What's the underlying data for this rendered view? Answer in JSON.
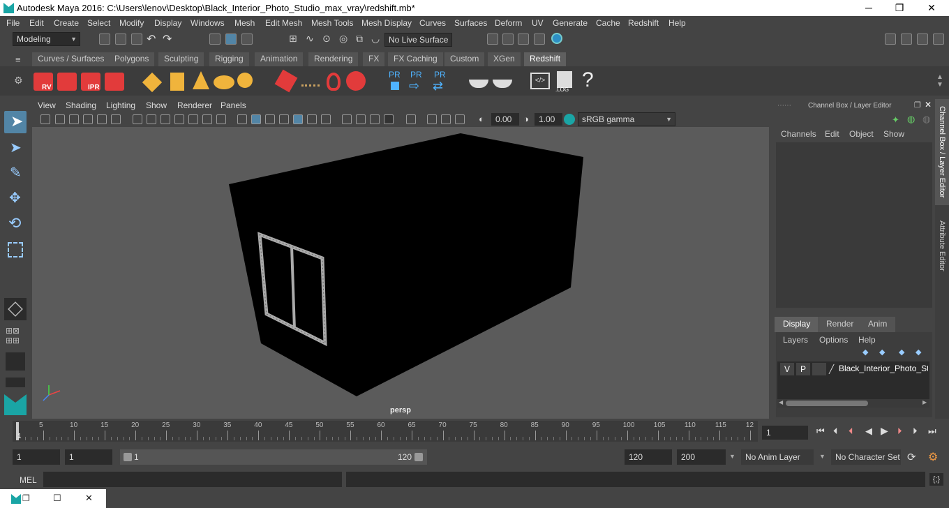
{
  "title": "Autodesk Maya 2016: C:\\Users\\lenov\\Desktop\\Black_Interior_Photo_Studio_max_vray\\redshift.mb*",
  "window_controls": {
    "minimize": "─",
    "maximize": "❐",
    "close": "✕"
  },
  "menu": [
    "File",
    "Edit",
    "Create",
    "Select",
    "Modify",
    "Display",
    "Windows",
    "Mesh",
    "Edit Mesh",
    "Mesh Tools",
    "Mesh Display",
    "Curves",
    "Surfaces",
    "Deform",
    "UV",
    "Generate",
    "Cache",
    "Redshift",
    "Help"
  ],
  "status": {
    "mode": "Modeling",
    "live_surface": "No Live Surface"
  },
  "shelf_tabs": [
    "Curves / Surfaces",
    "Polygons",
    "Sculpting",
    "Rigging",
    "Animation",
    "Rendering",
    "FX",
    "FX Caching",
    "Custom",
    "XGen",
    "Redshift"
  ],
  "active_shelf_tab": "Redshift",
  "shelf_labels": {
    "rv": "RV",
    "ipr": "IPR",
    "pr": "PR",
    "log": ".LOG",
    "help": "?"
  },
  "viewport_menu": [
    "View",
    "Shading",
    "Lighting",
    "Show",
    "Renderer",
    "Panels"
  ],
  "viewport_toolbar": {
    "exposure": "0.00",
    "gamma": "1.00",
    "colorspace": "sRGB gamma"
  },
  "camera_label": "persp",
  "channel_box": {
    "title": "Channel Box / Layer Editor",
    "menu": [
      "Channels",
      "Edit",
      "Object",
      "Show"
    ],
    "layer_tabs": [
      "Display",
      "Render",
      "Anim"
    ],
    "active_layer_tab": "Display",
    "layer_menu": [
      "Layers",
      "Options",
      "Help"
    ],
    "layers": [
      {
        "v": "V",
        "p": "P",
        "name": "Black_Interior_Photo_Stu"
      }
    ]
  },
  "side_tabs": [
    "Channel Box / Layer Editor",
    "Attribute Editor"
  ],
  "timeline": {
    "ticks": [
      "5",
      "10",
      "15",
      "20",
      "25",
      "30",
      "35",
      "40",
      "45",
      "50",
      "55",
      "60",
      "65",
      "70",
      "75",
      "80",
      "85",
      "90",
      "95",
      "100",
      "105",
      "110",
      "115",
      "12"
    ],
    "current_frame_marker": "1",
    "current_frame": "1"
  },
  "range": {
    "start": "1",
    "playback_start": "1",
    "range_start": "1",
    "range_end": "120",
    "playback_end": "120",
    "end": "200",
    "anim_layer": "No Anim Layer",
    "character_set": "No Character Set"
  },
  "command_line": {
    "label": "MEL"
  },
  "colors": {
    "accent": "#5285a6",
    "viewport": "#5b5b5b",
    "redshift": "#e23b3b"
  }
}
